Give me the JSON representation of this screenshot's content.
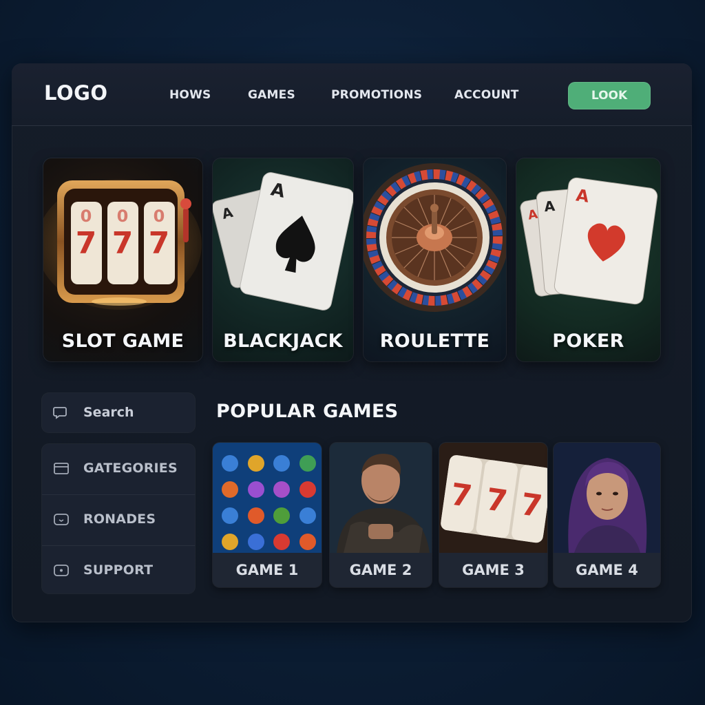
{
  "navbar": {
    "logo": "LOGO",
    "links": [
      "HOWS",
      "GAMES",
      "PROMOTIONS",
      "ACCOUNT"
    ],
    "cta_label": "LOOK",
    "cta_color": "#4fae78"
  },
  "featured_games": [
    {
      "label": "SLOT GAME",
      "icon": "slot-machine-icon"
    },
    {
      "label": "BLACKJACK",
      "icon": "playing-cards-spade-icon"
    },
    {
      "label": "ROULETTE",
      "icon": "roulette-wheel-icon"
    },
    {
      "label": "POKER",
      "icon": "playing-cards-heart-icon"
    }
  ],
  "sidebar": {
    "search_placeholder": "Search",
    "items": [
      {
        "label": "GATEGORIES",
        "icon": "categories-icon"
      },
      {
        "label": "RONADES",
        "icon": "ronades-icon"
      },
      {
        "label": "SUPPORT",
        "icon": "support-icon"
      }
    ]
  },
  "popular": {
    "title": "POPULAR GAMES",
    "games": [
      {
        "label": "GAME 1",
        "icon": "gem-match-icon"
      },
      {
        "label": "GAME 2",
        "icon": "warrior-portrait-icon"
      },
      {
        "label": "GAME 3",
        "icon": "slot-reels-icon"
      },
      {
        "label": "GAME 4",
        "icon": "woman-portrait-icon"
      }
    ]
  }
}
